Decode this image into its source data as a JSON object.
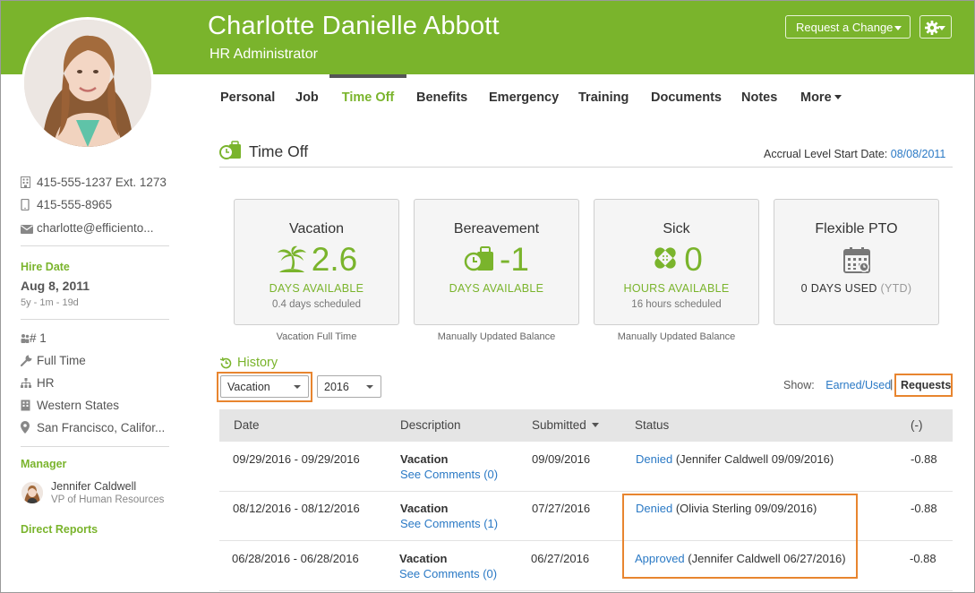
{
  "employee": {
    "name": "Charlotte Danielle Abbott",
    "title": "HR Administrator"
  },
  "header": {
    "request_change_label": "Request a Change",
    "settings_icon": "gear-icon"
  },
  "sidebar": {
    "work_phone": "415-555-1237 Ext. 1273",
    "mobile_phone": "415-555-8965",
    "email": "charlotte@efficiento...",
    "hire_date_label": "Hire Date",
    "hire_date": "Aug 8, 2011",
    "tenure": "5y - 1m - 19d",
    "employee_number": "# 1",
    "employment_status": "Full Time",
    "department": "HR",
    "division": "Western States",
    "location": "San Francisco, Califor...",
    "manager_label": "Manager",
    "manager_name": "Jennifer Caldwell",
    "manager_title": "VP of Human Resources",
    "direct_reports_label": "Direct Reports"
  },
  "nav": {
    "tabs": [
      "Personal",
      "Job",
      "Time Off",
      "Benefits",
      "Emergency",
      "Training",
      "Documents",
      "Notes",
      "More"
    ],
    "active": "Time Off"
  },
  "section": {
    "title": "Time Off",
    "accrual_label": "Accrual Level Start Date:",
    "accrual_date": "08/08/2011"
  },
  "cards": [
    {
      "title": "Vacation",
      "value": "2.6",
      "unit": "DAYS AVAILABLE",
      "scheduled": "0.4 days scheduled",
      "caption": "Vacation Full Time",
      "icon": "palm-tree-icon"
    },
    {
      "title": "Bereavement",
      "value": "-1",
      "unit": "DAYS AVAILABLE",
      "scheduled": "",
      "caption": "Manually Updated Balance",
      "icon": "suitcase-clock-icon"
    },
    {
      "title": "Sick",
      "value": "0",
      "unit": "HOURS AVAILABLE",
      "scheduled": "16 hours scheduled",
      "caption": "Manually Updated Balance",
      "icon": "bandage-icon"
    },
    {
      "title": "Flexible PTO",
      "value": "",
      "unit": "0 DAYS USED",
      "unit_suffix": "(YTD)",
      "scheduled": "",
      "caption": "",
      "icon": "calendar-icon"
    }
  ],
  "history": {
    "title": "History",
    "type_filter": "Vacation",
    "year_filter": "2016",
    "show_label": "Show:",
    "earned_used_label": "Earned/Used",
    "separator": "|",
    "requests_label": "Requests"
  },
  "table": {
    "columns": [
      "Date",
      "Description",
      "Submitted",
      "Status",
      "(-)"
    ],
    "rows": [
      {
        "date": "09/29/2016 - 09/29/2016",
        "type": "Vacation",
        "comments": "See Comments (0)",
        "submitted": "09/09/2016",
        "status": "Denied",
        "status_detail": "(Jennifer Caldwell 09/09/2016)",
        "amount": "-0.88"
      },
      {
        "date": "08/12/2016 - 08/12/2016",
        "type": "Vacation",
        "comments": "See Comments (1)",
        "submitted": "07/27/2016",
        "status": "Denied",
        "status_detail": "(Olivia Sterling 09/09/2016)",
        "amount": "-0.88"
      },
      {
        "date": "06/28/2016 - 06/28/2016",
        "type": "Vacation",
        "comments": "See Comments (0)",
        "submitted": "06/27/2016",
        "status": "Approved",
        "status_detail": "(Jennifer Caldwell 06/27/2016)",
        "amount": "-0.88"
      }
    ]
  },
  "colors": {
    "brand_green": "#7ab42c",
    "link_blue": "#2a79c5",
    "highlight_orange": "#e8852f"
  }
}
